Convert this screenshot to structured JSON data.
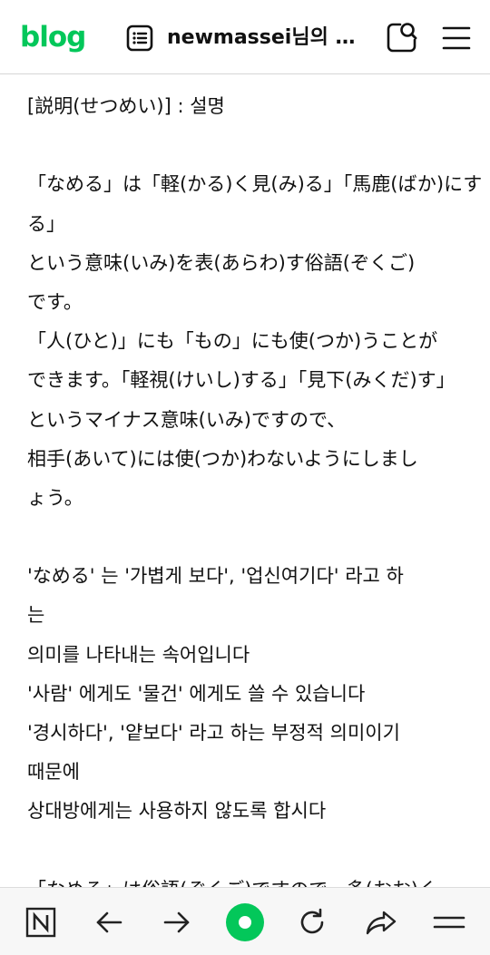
{
  "header": {
    "logo": "blog",
    "title": "newmassei님의 블..."
  },
  "icons": {
    "post_list": "post-list-icon",
    "search": "search-icon",
    "menu": "menu-icon"
  },
  "content_lines": [
    "[説明(せつめい)] : 설명",
    "",
    "「なめる」は「軽(かる)く見(み)る」「馬鹿(ばか)にす",
    "る」",
    "という意味(いみ)を表(あらわ)す俗語(ぞくご)",
    "です。",
    "「人(ひと)」にも「もの」にも使(つか)うことが",
    "できます。「軽視(けいし)する」「見下(みくだ)す」",
    "というマイナス意味(いみ)ですので、",
    "相手(あいて)には使(つか)わないようにしまし",
    "ょう。",
    "",
    "'なめる' 는 '가볍게 보다', '업신여기다' 라고 하",
    "는",
    "의미를 나타내는 속어입니다",
    "'사람' 에게도 '물건' 에게도 쓸 수 있습니다",
    "'경시하다', '얕보다' 라고 하는 부정적 의미이기",
    "때문에",
    "상대방에게는 사용하지 않도록 합시다",
    "",
    "「なめる」は俗語(ぞくご)ですので、多(おお)く"
  ],
  "bottom_bar": {
    "items": [
      "naver-n-icon",
      "back-arrow-icon",
      "forward-arrow-icon",
      "home-dot-icon",
      "refresh-icon",
      "share-icon",
      "more-menu-icon"
    ]
  },
  "colors": {
    "brand_green": "#03c75a",
    "text": "#111111",
    "bar_bg": "#f7f7f7"
  }
}
